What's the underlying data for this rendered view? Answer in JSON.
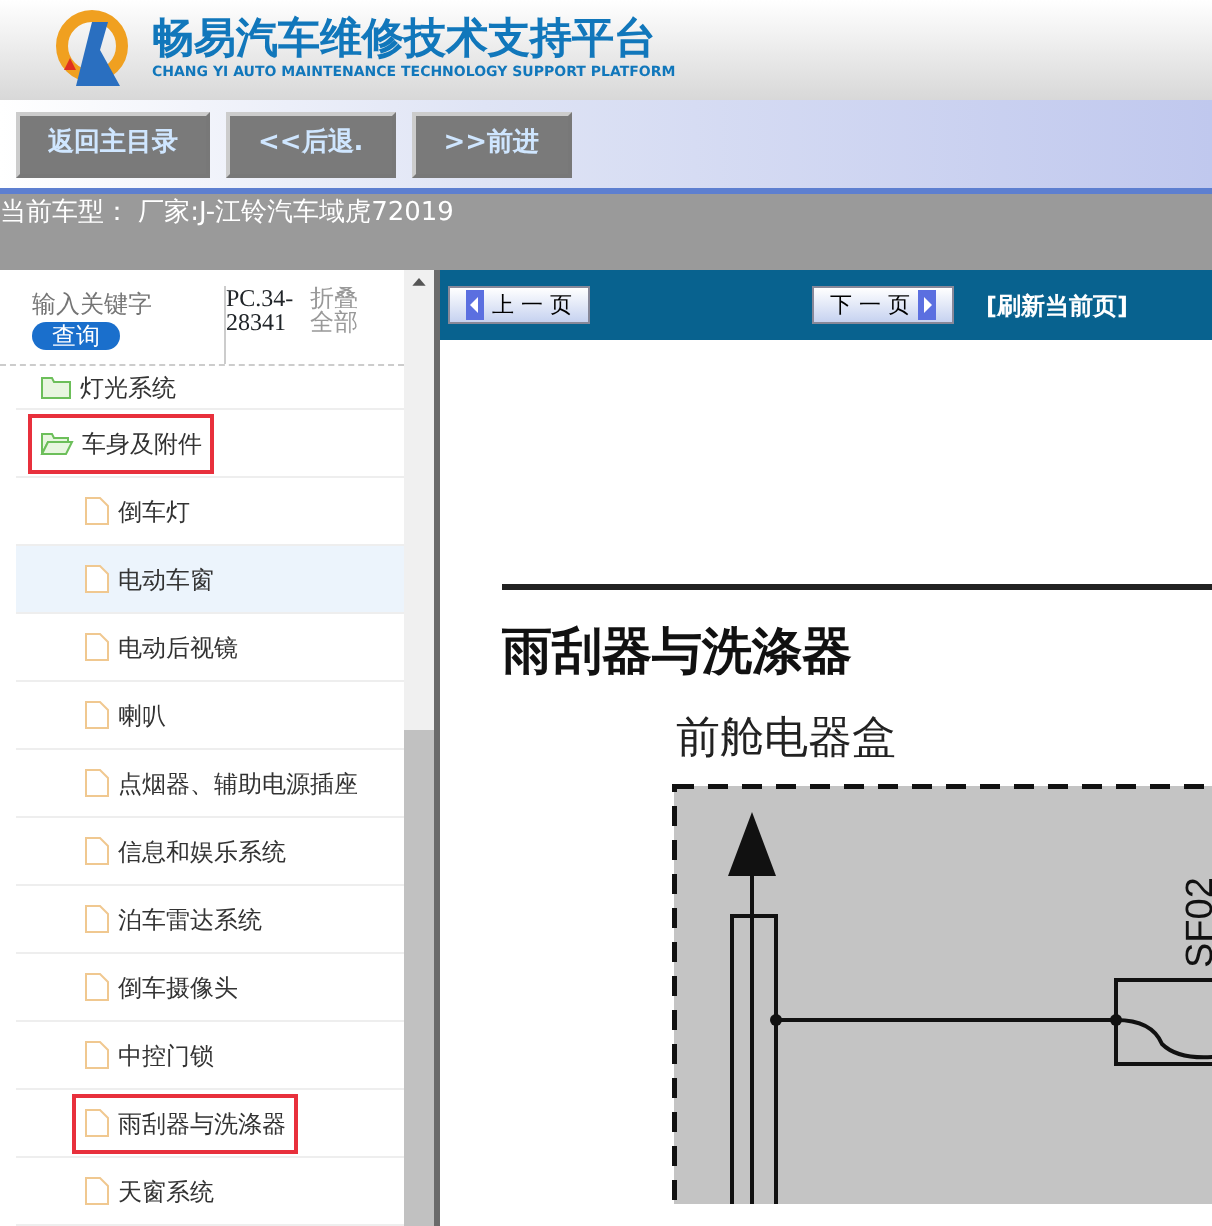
{
  "header": {
    "title": "畅易汽车维修技术支持平台",
    "subtitle": "CHANG YI AUTO MAINTENANCE TECHNOLOGY SUPPORT PLATFORM"
  },
  "toolbar": {
    "buttons": [
      "返回主目录",
      "<<后退.",
      ">>前进"
    ]
  },
  "current_model": "当前车型： 厂家:J-江铃汽车域虎72019",
  "sidebar": {
    "search": {
      "placeholder": "输入关键字"
    },
    "search_button": "查询",
    "code": "PC.34-28341",
    "collapse_all": "折叠全部",
    "tree": [
      {
        "label": "灯光系统",
        "kind": "folder",
        "expanded": false,
        "selected": false,
        "marked": false
      },
      {
        "label": "车身及附件",
        "kind": "folder",
        "expanded": true,
        "selected": false,
        "marked": true,
        "children": [
          {
            "label": "倒车灯",
            "kind": "page",
            "selected": false,
            "marked": false
          },
          {
            "label": "电动车窗",
            "kind": "page",
            "selected": true,
            "marked": false
          },
          {
            "label": "电动后视镜",
            "kind": "page",
            "selected": false,
            "marked": false
          },
          {
            "label": "喇叭",
            "kind": "page",
            "selected": false,
            "marked": false
          },
          {
            "label": "点烟器、辅助电源插座",
            "kind": "page",
            "selected": false,
            "marked": false
          },
          {
            "label": "信息和娱乐系统",
            "kind": "page",
            "selected": false,
            "marked": false
          },
          {
            "label": "泊车雷达系统",
            "kind": "page",
            "selected": false,
            "marked": false
          },
          {
            "label": "倒车摄像头",
            "kind": "page",
            "selected": false,
            "marked": false
          },
          {
            "label": "中控门锁",
            "kind": "page",
            "selected": false,
            "marked": false
          },
          {
            "label": "雨刮器与洗涤器",
            "kind": "page",
            "selected": false,
            "marked": true
          },
          {
            "label": "天窗系统",
            "kind": "page",
            "selected": false,
            "marked": false
          }
        ]
      }
    ]
  },
  "pager": {
    "prev": "上 一 页",
    "next": "下 一 页",
    "refresh": "[刷新当前页]"
  },
  "document": {
    "heading": "雨刮器与洗涤器",
    "subheading": "前舱电器盒",
    "fuse_label": "SF02"
  }
}
